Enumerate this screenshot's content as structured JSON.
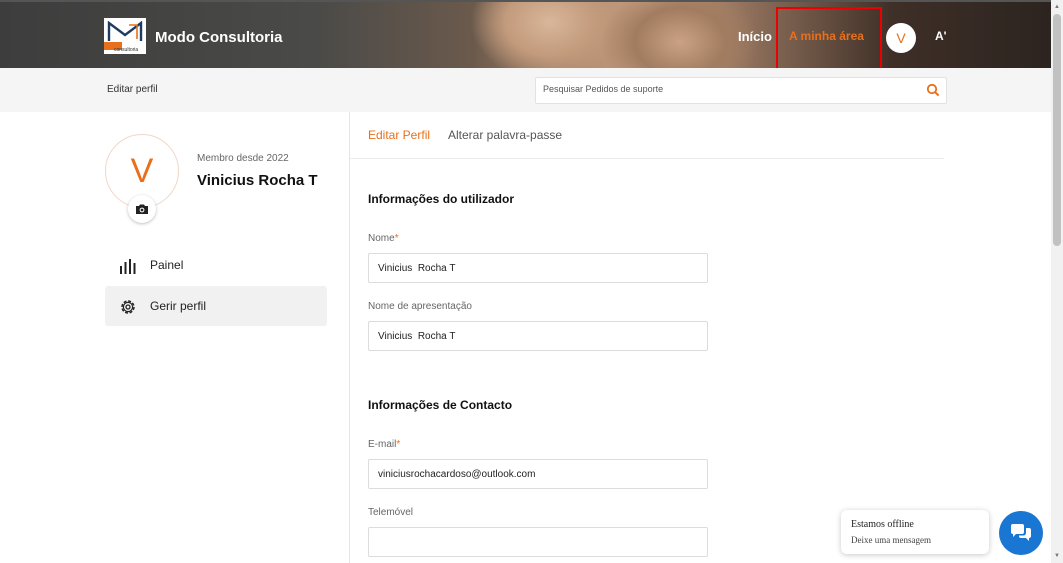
{
  "header": {
    "brand": "Modo Consultoria",
    "logo_small_text": "consultoria",
    "nav_inicio": "Início",
    "nav_area": "A minha área",
    "avatar_initial": "V",
    "accessibility_label": "A'",
    "accent_color": "#e8701c"
  },
  "subbar": {
    "breadcrumb": "Editar perfil",
    "search_placeholder": "Pesquisar Pedidos de suporte"
  },
  "profile": {
    "avatar_initial": "V",
    "member_since": "Membro desde 2022",
    "name": "Vinicius Rocha T"
  },
  "menu": {
    "painel": "Painel",
    "gerir": "Gerir perfil"
  },
  "tabs": {
    "edit": "Editar Perfil",
    "password": "Alterar palavra-passe"
  },
  "form": {
    "user_section": "Informações do utilizador",
    "name_label": "Nome",
    "name_value": "Vinicius  Rocha T",
    "display_label": "Nome de apresentação",
    "display_value": "Vinicius  Rocha T",
    "contact_section": "Informações de Contacto",
    "email_label": "E-mail",
    "email_value": "viniciusrochacardoso@outlook.com",
    "phone_label": "Telemóvel",
    "phone_value": "",
    "required_mark": "*"
  },
  "chat": {
    "status": "Estamos offline",
    "message": "Deixe uma mensagem",
    "button_color": "#1976d2"
  }
}
